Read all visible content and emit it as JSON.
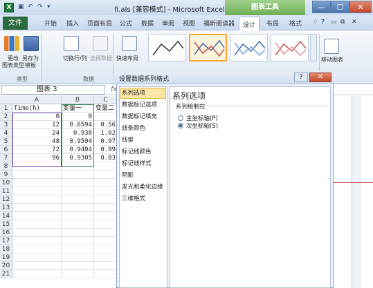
{
  "titlebar": {
    "app_icon": "X",
    "quick_access": [
      "▣",
      "↶",
      "↷",
      "▾"
    ],
    "title": "fi.als [兼容模式] - Microsoft Excel",
    "context_tab": "图表工具",
    "min_icon": "—",
    "max_icon": "☐",
    "close_icon": "✕"
  },
  "menu": {
    "file": "文件",
    "tabs": [
      "开始",
      "插入",
      "页面布局",
      "公式",
      "数据",
      "审阅",
      "视图",
      "福昕阅读器",
      "设计",
      "布局",
      "格式"
    ],
    "selected_tab": "设计",
    "right_icons": [
      "♢",
      "?",
      "▭",
      "⧉",
      "✕"
    ]
  },
  "ribbon": {
    "groups": [
      {
        "label": "类型",
        "buttons": [
          {
            "label": "更改\n图表类型",
            "icon": "chart-type-icon"
          },
          {
            "label": "另存为\n模板",
            "icon": "save-template-icon"
          }
        ]
      },
      {
        "label": "数据",
        "buttons": [
          {
            "label": "切换行/列",
            "icon": "switch-icon"
          },
          {
            "label": "选择数据",
            "icon": "select-data-icon"
          }
        ]
      },
      {
        "label": "",
        "buttons": [
          {
            "label": "快速布局",
            "icon": "layout-icon"
          }
        ]
      }
    ],
    "move_chart_label": "移动图表"
  },
  "formula_bar": {
    "name_box": "图表 3",
    "fx": "fx"
  },
  "sheet": {
    "columns": [
      "A",
      "B",
      "C"
    ],
    "rows": [
      [
        "1",
        "Time(h)",
        "变量一",
        "变量二"
      ],
      [
        "2",
        "0",
        "0",
        ""
      ],
      [
        "3",
        "12",
        "0.6594",
        "0.56"
      ],
      [
        "4",
        "24",
        "0.938",
        "1.02"
      ],
      [
        "5",
        "48",
        "0.9594",
        "0.97"
      ],
      [
        "6",
        "72",
        "0.9404",
        "0.99"
      ],
      [
        "7",
        "96",
        "0.9305",
        "0.83"
      ],
      [
        "8",
        "",
        "",
        ""
      ],
      [
        "9",
        "",
        "",
        ""
      ],
      [
        "10",
        "",
        "",
        ""
      ],
      [
        "11",
        "",
        "",
        ""
      ],
      [
        "12",
        "",
        "",
        ""
      ],
      [
        "13",
        "",
        "",
        ""
      ],
      [
        "14",
        "",
        "",
        ""
      ],
      [
        "15",
        "",
        "",
        ""
      ],
      [
        "16",
        "",
        "",
        ""
      ],
      [
        "17",
        "",
        "",
        ""
      ],
      [
        "18",
        "",
        "",
        ""
      ],
      [
        "19",
        "",
        "",
        ""
      ],
      [
        "20",
        "",
        "",
        ""
      ],
      [
        "21",
        "",
        "",
        ""
      ]
    ]
  },
  "dialog": {
    "title": "设置数据系列格式",
    "help": "?",
    "close": "✕",
    "nav": [
      "系列选项",
      "数据标记选项",
      "数据标记填充",
      "线条颜色",
      "线型",
      "标记线颜色",
      "标记线样式",
      "阴影",
      "发光和柔化边缘",
      "三维格式"
    ],
    "selected_nav": "系列选项",
    "panel_title": "系列选项",
    "axis_group": "系列绘制在",
    "options": [
      {
        "label": "主坐标轴(P)",
        "checked": false
      },
      {
        "label": "次坐标轴(S)",
        "checked": true
      }
    ]
  }
}
